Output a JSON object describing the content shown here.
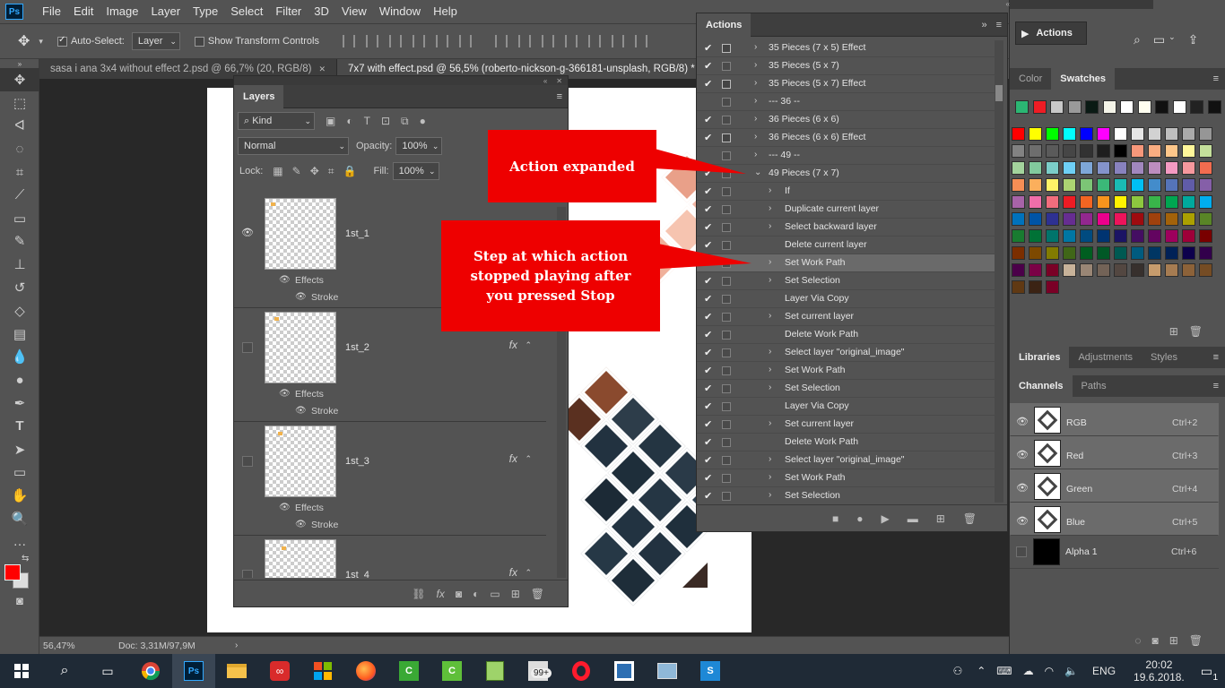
{
  "menubar": {
    "logo": "Ps",
    "items": [
      "File",
      "Edit",
      "Image",
      "Layer",
      "Type",
      "Select",
      "Filter",
      "3D",
      "View",
      "Window",
      "Help"
    ],
    "window_controls": [
      "—",
      "❐",
      "✕"
    ]
  },
  "options": {
    "auto_select_label": "Auto-Select:",
    "auto_select_value": "Layer",
    "show_transform_label": "Show Transform Controls"
  },
  "doc_tabs": [
    {
      "label": "sasa i ana 3x4 without effect 2.psd @ 66,7% (20, RGB/8)",
      "active": false
    },
    {
      "label": "7x7 with effect.psd @ 56,5% (roberto-nickson-g-366181-unsplash, RGB/8) *",
      "active": true
    }
  ],
  "status": {
    "zoom": "56,47%",
    "doc": "Doc: 3,31M/97,9M"
  },
  "layers_panel": {
    "tab": "Layers",
    "kind_label": "Kind",
    "blend_mode": "Normal",
    "opacity_label": "Opacity:",
    "opacity_value": "100%",
    "lock_label": "Lock:",
    "fill_label": "Fill:",
    "fill_value": "100%",
    "layers": [
      {
        "name": "1st_1",
        "visible": true,
        "effects": "Effects",
        "stroke": "Stroke",
        "fx": ""
      },
      {
        "name": "1st_2",
        "visible": false,
        "effects": "Effects",
        "stroke": "Stroke",
        "fx": "fx"
      },
      {
        "name": "1st_3",
        "visible": false,
        "effects": "Effects",
        "stroke": "Stroke",
        "fx": "fx"
      },
      {
        "name": "1st_4",
        "visible": false,
        "effects": "",
        "stroke": "",
        "fx": "fx"
      }
    ]
  },
  "actions_panel": {
    "tab": "Actions",
    "rows": [
      {
        "label": "35 Pieces (7 x 5) Effect",
        "check": true,
        "dialog": true,
        "indent": 0,
        "expanded": false
      },
      {
        "label": "35 Pieces (5 x 7)",
        "check": true,
        "dialog": false,
        "indent": 0,
        "expanded": false
      },
      {
        "label": "35 Pieces (5 x 7) Effect",
        "check": true,
        "dialog": true,
        "indent": 0,
        "expanded": false
      },
      {
        "label": "--- 36 --",
        "check": false,
        "dialog": false,
        "indent": 0,
        "expanded": false
      },
      {
        "label": "36 Pieces (6 x 6)",
        "check": true,
        "dialog": false,
        "indent": 0,
        "expanded": false
      },
      {
        "label": "36 Pieces (6 x 6) Effect",
        "check": true,
        "dialog": true,
        "indent": 0,
        "expanded": false
      },
      {
        "label": "--- 49 --",
        "check": false,
        "dialog": false,
        "indent": 0,
        "expanded": false
      },
      {
        "label": "49 Pieces (7 x 7)",
        "check": true,
        "dialog": false,
        "indent": 0,
        "expanded": true
      },
      {
        "label": "If",
        "check": true,
        "dialog": false,
        "indent": 1,
        "expanded": false
      },
      {
        "label": "Duplicate current layer",
        "check": true,
        "dialog": false,
        "indent": 1,
        "expanded": false
      },
      {
        "label": "Select backward layer",
        "check": true,
        "dialog": false,
        "indent": 1,
        "expanded": false
      },
      {
        "label": "Delete current layer",
        "check": true,
        "dialog": false,
        "indent": 1,
        "expanded": null
      },
      {
        "label": "Set Work Path",
        "check": true,
        "dialog": false,
        "indent": 1,
        "expanded": false,
        "highlight": true
      },
      {
        "label": "Set Selection",
        "check": true,
        "dialog": false,
        "indent": 1,
        "expanded": false
      },
      {
        "label": "Layer Via Copy",
        "check": true,
        "dialog": false,
        "indent": 1,
        "expanded": null
      },
      {
        "label": "Set current layer",
        "check": true,
        "dialog": false,
        "indent": 1,
        "expanded": false
      },
      {
        "label": "Delete Work Path",
        "check": true,
        "dialog": false,
        "indent": 1,
        "expanded": null
      },
      {
        "label": "Select layer \"original_image\"",
        "check": true,
        "dialog": false,
        "indent": 1,
        "expanded": false
      },
      {
        "label": "Set Work Path",
        "check": true,
        "dialog": false,
        "indent": 1,
        "expanded": false
      },
      {
        "label": "Set Selection",
        "check": true,
        "dialog": false,
        "indent": 1,
        "expanded": false
      },
      {
        "label": "Layer Via Copy",
        "check": true,
        "dialog": false,
        "indent": 1,
        "expanded": null
      },
      {
        "label": "Set current layer",
        "check": true,
        "dialog": false,
        "indent": 1,
        "expanded": false
      },
      {
        "label": "Delete Work Path",
        "check": true,
        "dialog": false,
        "indent": 1,
        "expanded": null
      },
      {
        "label": "Select layer \"original_image\"",
        "check": true,
        "dialog": false,
        "indent": 1,
        "expanded": false
      },
      {
        "label": "Set Work Path",
        "check": true,
        "dialog": false,
        "indent": 1,
        "expanded": false
      },
      {
        "label": "Set Selection",
        "check": true,
        "dialog": false,
        "indent": 1,
        "expanded": false
      }
    ]
  },
  "callouts": {
    "action_expanded": "Action expanded",
    "step_stopped": "Step at which action stopped playing after you pressed Stop"
  },
  "right_dock": {
    "actions_button": "Actions",
    "color_tab": "Color",
    "swatches_tab": "Swatches",
    "libraries_tab": "Libraries",
    "adjustments_tab": "Adjustments",
    "styles_tab": "Styles",
    "channels_tab": "Channels",
    "paths_tab": "Paths",
    "channels": [
      {
        "name": "RGB",
        "shortcut": "Ctrl+2",
        "visible": true
      },
      {
        "name": "Red",
        "shortcut": "Ctrl+3",
        "visible": true
      },
      {
        "name": "Green",
        "shortcut": "Ctrl+4",
        "visible": true
      },
      {
        "name": "Blue",
        "shortcut": "Ctrl+5",
        "visible": true
      },
      {
        "name": "Alpha 1",
        "shortcut": "Ctrl+6",
        "visible": false
      }
    ],
    "swatch_colors": [
      "#2bb673",
      "#ee1c24",
      "#c8c8c8",
      "#9a9a9a",
      "#0a1a14",
      "#f4f4e8",
      "#ffffff",
      "#fffef0",
      "#111111",
      "#ffffff",
      "#222222",
      "#111111",
      "#333333",
      "#ff0000",
      "#ffff00",
      "#00ff00",
      "#00ffff",
      "#0000ff",
      "#ff00ff",
      "#ffffff",
      "#e6e6e6",
      "#d2d2d2",
      "#bebebe",
      "#aaaaaa",
      "#969696",
      "#828282",
      "#6e6e6e",
      "#5a5a5a",
      "#464646",
      "#323232",
      "#1e1e1e",
      "#000000",
      "#f7977a",
      "#f9ad81",
      "#fdc68a",
      "#fff79a",
      "#c4df9b",
      "#a3d39c",
      "#82ca9d",
      "#7bcdc8",
      "#6ecff6",
      "#7ea7d8",
      "#8493ca",
      "#8882be",
      "#a187be",
      "#bc8dbf",
      "#f49ac2",
      "#f6989d",
      "#f26c4f",
      "#f68e55",
      "#fbaf5c",
      "#fff467",
      "#acd372",
      "#7cc576",
      "#3bb878",
      "#1abbb4",
      "#00bff3",
      "#438ccb",
      "#5574b9",
      "#605ca8",
      "#855fa8",
      "#a763a8",
      "#f06eaa",
      "#f26d7d",
      "#ed1c24",
      "#f26522",
      "#f7941d",
      "#fff200",
      "#8dc73f",
      "#39b54a",
      "#00a651",
      "#00a99d",
      "#00aeef",
      "#0072bc",
      "#0054a6",
      "#2e3192",
      "#662d91",
      "#92278f",
      "#ec008c",
      "#ed145b",
      "#9e0b0f",
      "#a0410d",
      "#a3620a",
      "#aba000",
      "#598527",
      "#197b30",
      "#007236",
      "#00746b",
      "#0076a3",
      "#004b80",
      "#003471",
      "#1b1464",
      "#440e62",
      "#630460",
      "#9e005d",
      "#9e0039",
      "#790000",
      "#7b2e00",
      "#7d4900",
      "#827b00",
      "#406618",
      "#005e20",
      "#005826",
      "#005952",
      "#005b7f",
      "#003663",
      "#002157",
      "#0d004c",
      "#32004b",
      "#4b0049",
      "#7b0046",
      "#7a0026",
      "#c7b299",
      "#998675",
      "#736357",
      "#534741",
      "#37302d",
      "#c69c6d",
      "#a67c52",
      "#8c6239",
      "#754c24",
      "#603913",
      "#3b2314",
      "#7a0026"
    ]
  },
  "taskbar": {
    "badge": "99+",
    "lang": "ENG",
    "time": "20:02",
    "date": "19.6.2018.",
    "notifications": "1"
  }
}
